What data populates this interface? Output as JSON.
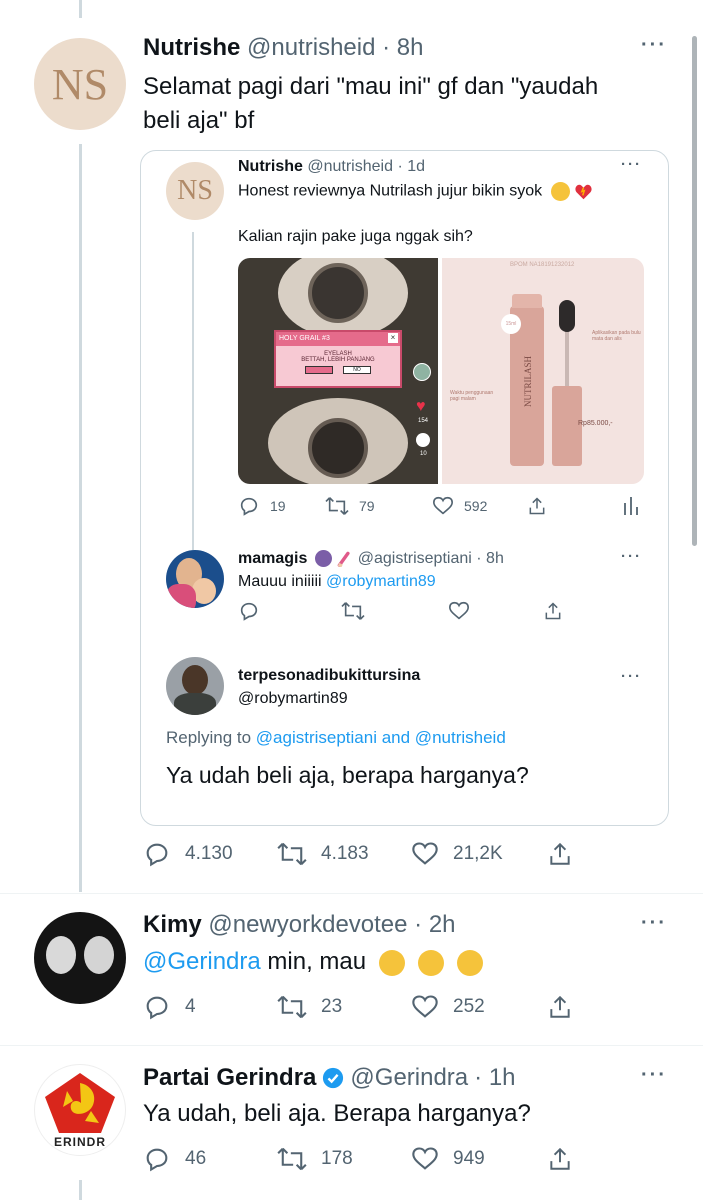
{
  "tweet1": {
    "avatar_text": "NS",
    "name": "Nutrishe",
    "handle": "@nutrisheid",
    "time": "· 8h",
    "text_line1": "Selamat pagi dari \"mau ini\" gf dan \"yaudah",
    "text_line2": "beli aja\" bf",
    "replies": "4.130",
    "retweets": "4.183",
    "likes": "21,2K"
  },
  "quote": {
    "avatar_text": "NS",
    "name": "Nutrishe",
    "handle": "@nutrisheid",
    "time": "· 1d",
    "text": "Honest reviewnya Nutrilash jujur bikin syok",
    "text2": "Kalian rajin pake juga nggak sih?",
    "replies": "19",
    "retweets": "79",
    "likes": "592",
    "media": {
      "dialog_title": "HOLY GRAIL #3",
      "dialog_line1": "EYELASH",
      "dialog_line2": "BETTAH, LEBIH PANJANG",
      "side_count1": "154",
      "side_count2": "10",
      "bpom": "BPOM NA18191232012",
      "product": "NUTRILASH",
      "size": "15ml",
      "price": "Rp85.000,-",
      "note1": "Aplikasikan pada bulu mata dan alis",
      "note2": "Waktu penggunaan pagi malam"
    },
    "reply1": {
      "name": "mamagis",
      "handle": "@agistriseptiani",
      "time": "· 8h",
      "text": "Mauuu iniiiii",
      "mention": "@robymartin89"
    },
    "reply2": {
      "name": "terpesonadibukittursina",
      "handle": "@robymartin89",
      "replying_label": "Replying to",
      "replying_to": "@agistriseptiani and @nutrisheid",
      "text": "Ya udah beli aja, berapa harganya?"
    }
  },
  "tweet2": {
    "name": "Kimy",
    "handle": "@newyorkdevotee",
    "time": "· 2h",
    "mention": "@Gerindra",
    "text": " min, mau ",
    "replies": "4",
    "retweets": "23",
    "likes": "252"
  },
  "tweet3": {
    "name": "Partai Gerindra",
    "handle": "@Gerindra",
    "time": "· 1h",
    "text": "Ya udah, beli aja. Berapa harganya?",
    "logo_text": "ERINDR",
    "replies": "46",
    "retweets": "178",
    "likes": "949"
  },
  "colors": {
    "link": "#1d9bf0",
    "muted": "#536471",
    "verified": "#1d9bf0",
    "heart": "#f91880"
  }
}
